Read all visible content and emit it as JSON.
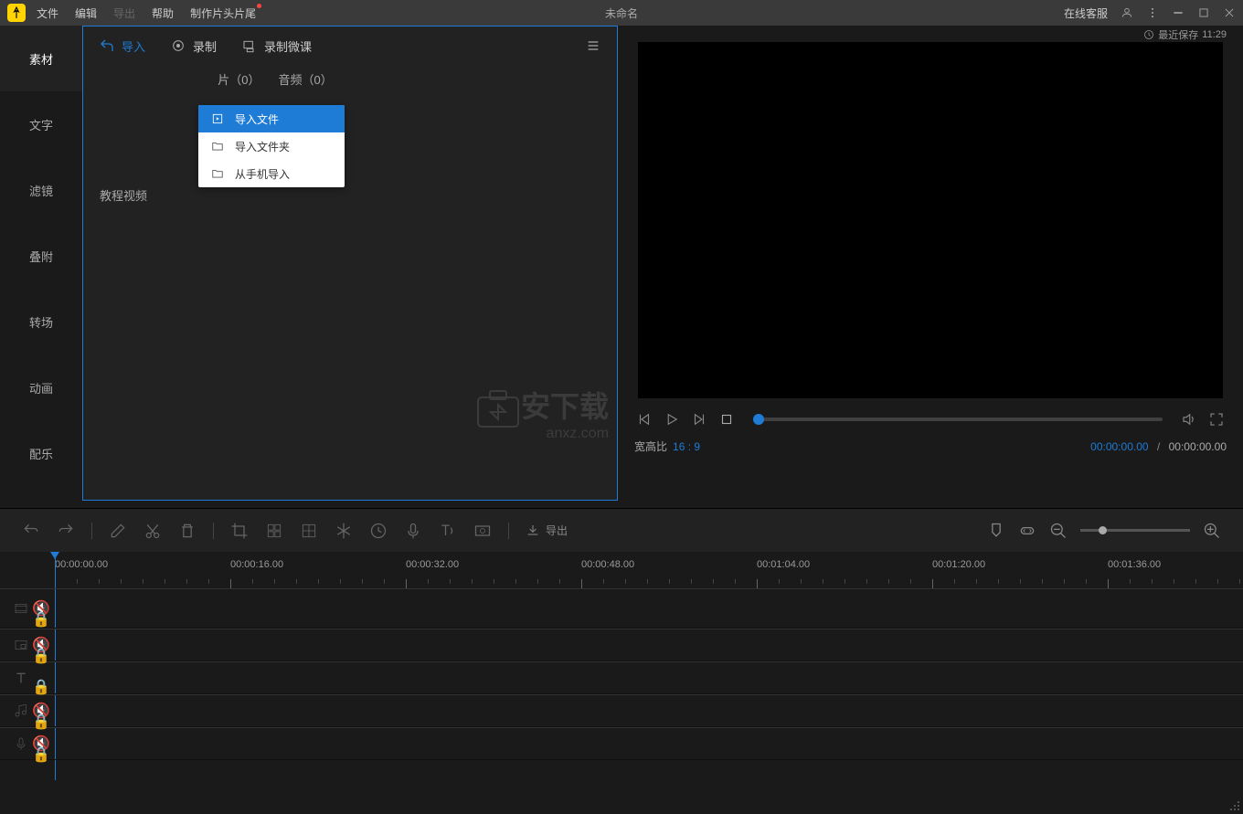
{
  "titlebar": {
    "menus": [
      "文件",
      "编辑",
      "导出",
      "帮助",
      "制作片头片尾"
    ],
    "title": "未命名",
    "customer_service": "在线客服",
    "save_label": "最近保存",
    "save_time": "11:29"
  },
  "sidebar": {
    "tabs": [
      "素材",
      "文字",
      "滤镜",
      "叠附",
      "转场",
      "动画",
      "配乐"
    ]
  },
  "media_panel": {
    "import": "导入",
    "record": "录制",
    "record_lesson": "录制微课",
    "media_tab_suffix": "片（0）",
    "audio_tab": "音频（0）",
    "tutorial": "教程视频"
  },
  "dropdown": {
    "items": [
      "导入文件",
      "导入文件夹",
      "从手机导入"
    ]
  },
  "preview": {
    "aspect_label": "宽高比",
    "aspect_value": "16 : 9",
    "current_time": "00:00:00.00",
    "total_time": "00:00:00.00"
  },
  "timeline_toolbar": {
    "export": "导出"
  },
  "ruler": {
    "marks": [
      "00:00:00.00",
      "00:00:16.00",
      "00:00:32.00",
      "00:00:48.00",
      "00:01:04.00",
      "00:01:20.00",
      "00:01:36.00"
    ]
  },
  "watermark": {
    "text": "安下载",
    "url": "anxz.com"
  }
}
